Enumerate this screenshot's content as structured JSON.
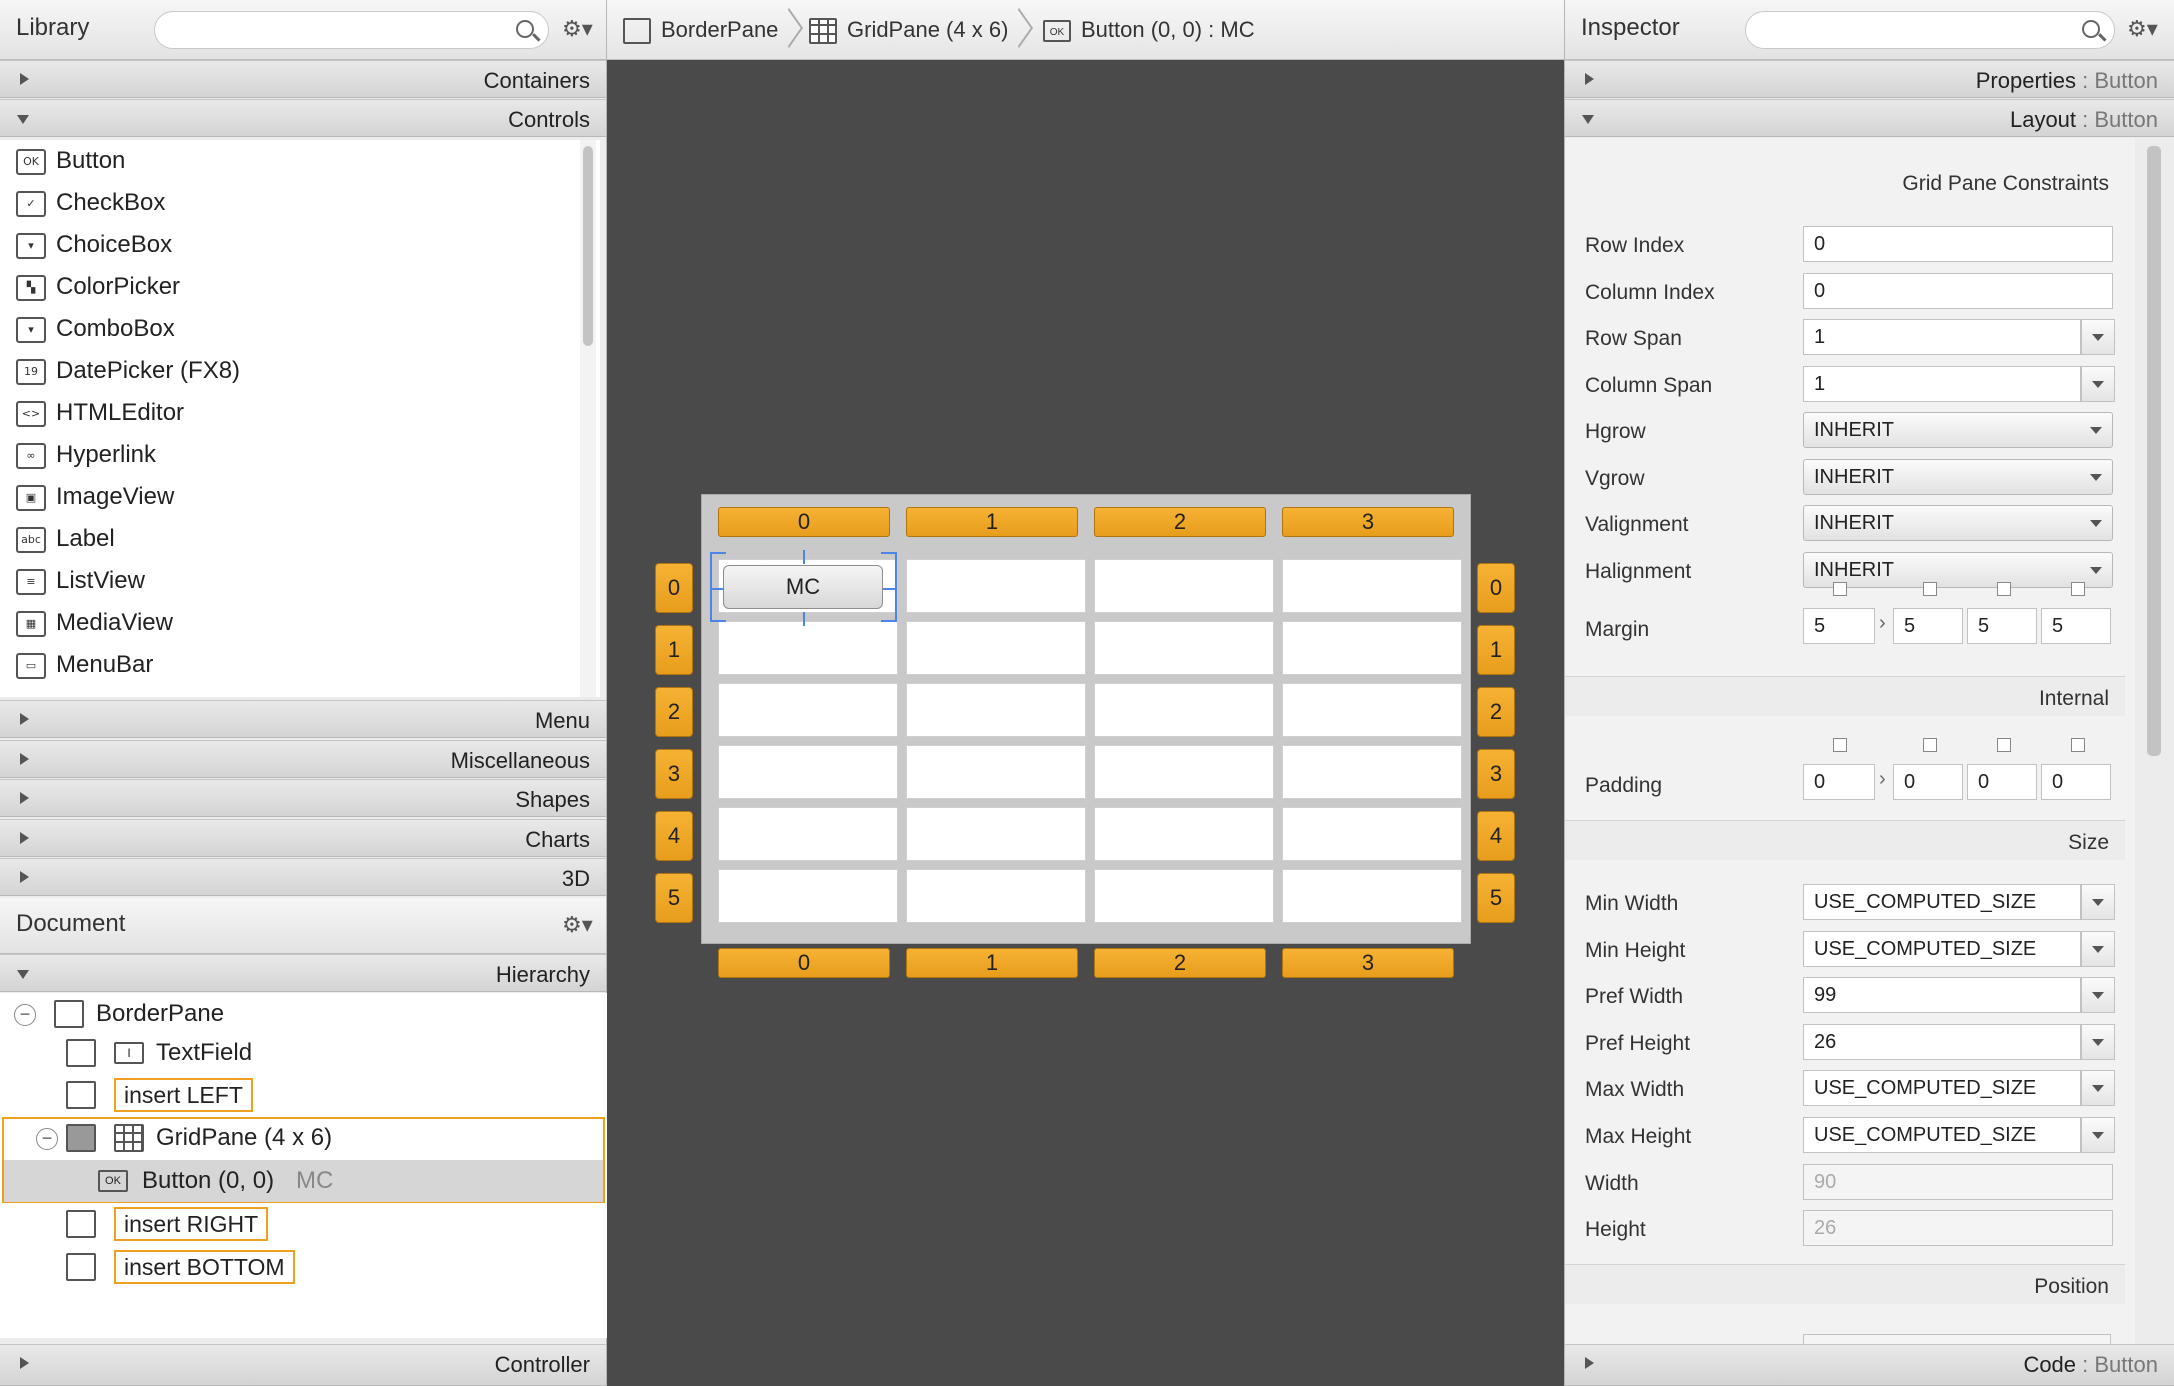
{
  "library": {
    "title": "Library",
    "sections_top": [
      "Containers",
      "Controls"
    ],
    "items": [
      {
        "label": "Button",
        "icon": "OK"
      },
      {
        "label": "CheckBox",
        "icon": "✓"
      },
      {
        "label": "ChoiceBox",
        "icon": "▾"
      },
      {
        "label": "ColorPicker",
        "icon": "▚"
      },
      {
        "label": "ComboBox",
        "icon": "▾"
      },
      {
        "label": "DatePicker  (FX8)",
        "icon": "19"
      },
      {
        "label": "HTMLEditor",
        "icon": "<>"
      },
      {
        "label": "Hyperlink",
        "icon": "∞"
      },
      {
        "label": "ImageView",
        "icon": "▣"
      },
      {
        "label": "Label",
        "icon": "abc"
      },
      {
        "label": "ListView",
        "icon": "≡"
      },
      {
        "label": "MediaView",
        "icon": "▦"
      },
      {
        "label": "MenuBar",
        "icon": "▭"
      }
    ],
    "sections_bottom": [
      "Menu",
      "Miscellaneous",
      "Shapes",
      "Charts",
      "3D"
    ]
  },
  "document": {
    "title": "Document",
    "hierarchy_label": "Hierarchy",
    "controller_label": "Controller",
    "tree": {
      "root": "BorderPane",
      "textfield": "TextField",
      "insert_left": "insert LEFT",
      "gridpane": "GridPane (4 x 6)",
      "button": "Button (0, 0)",
      "button_id": "MC",
      "insert_right": "insert RIGHT",
      "insert_bottom": "insert BOTTOM"
    }
  },
  "breadcrumb": {
    "items": [
      "BorderPane",
      "GridPane (4 x 6)",
      "Button (0, 0) : MC"
    ]
  },
  "grid": {
    "col_headers": [
      "0",
      "1",
      "2",
      "3"
    ],
    "row_headers": [
      "0",
      "1",
      "2",
      "3",
      "4",
      "5"
    ],
    "button_text": "MC",
    "accent": "#f0a020"
  },
  "inspector": {
    "title": "Inspector",
    "properties_label": "Properties",
    "properties_ctx": ": Button",
    "layout_label": "Layout",
    "layout_ctx": ": Button",
    "constraints_title": "Grid Pane Constraints",
    "fields": {
      "row_index": {
        "label": "Row Index",
        "value": "0"
      },
      "column_index": {
        "label": "Column Index",
        "value": "0"
      },
      "row_span": {
        "label": "Row Span",
        "value": "1"
      },
      "column_span": {
        "label": "Column Span",
        "value": "1"
      },
      "hgrow": {
        "label": "Hgrow",
        "value": "INHERIT"
      },
      "vgrow": {
        "label": "Vgrow",
        "value": "INHERIT"
      },
      "valignment": {
        "label": "Valignment",
        "value": "INHERIT"
      },
      "halignment": {
        "label": "Halignment",
        "value": "INHERIT"
      },
      "margin": {
        "label": "Margin",
        "values": [
          "5",
          "5",
          "5",
          "5"
        ]
      }
    },
    "internal_title": "Internal",
    "padding": {
      "label": "Padding",
      "values": [
        "0",
        "0",
        "0",
        "0"
      ]
    },
    "size_title": "Size",
    "size_fields": {
      "min_width": {
        "label": "Min Width",
        "value": "USE_COMPUTED_SIZE"
      },
      "min_height": {
        "label": "Min Height",
        "value": "USE_COMPUTED_SIZE"
      },
      "pref_width": {
        "label": "Pref Width",
        "value": "99"
      },
      "pref_height": {
        "label": "Pref Height",
        "value": "26"
      },
      "max_width": {
        "label": "Max Width",
        "value": "USE_COMPUTED_SIZE"
      },
      "max_height": {
        "label": "Max Height",
        "value": "USE_COMPUTED_SIZE"
      },
      "width": {
        "label": "Width",
        "value": "90"
      },
      "height": {
        "label": "Height",
        "value": "26"
      }
    },
    "position_title": "Position",
    "code_label": "Code",
    "code_ctx": ": Button"
  }
}
